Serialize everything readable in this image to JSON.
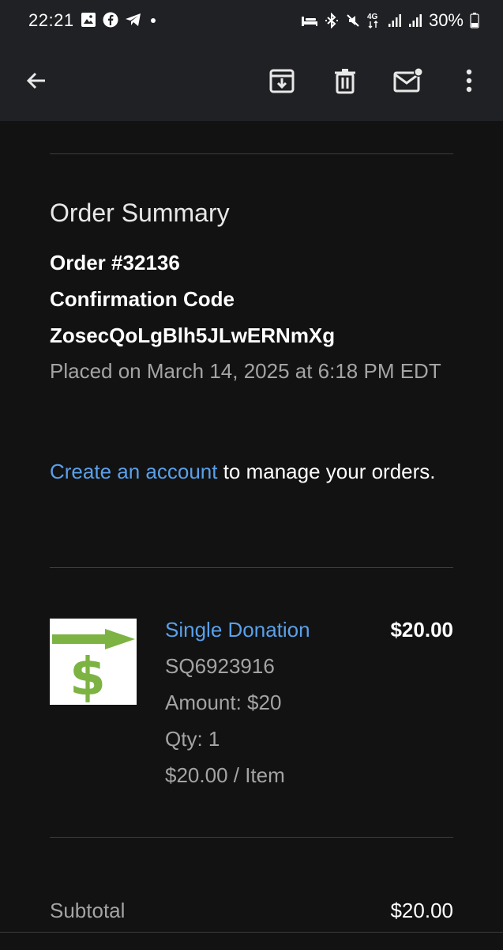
{
  "status_bar": {
    "time": "22:21",
    "battery_percent": "30%",
    "network_label": "4G",
    "left_icons": [
      "image-icon",
      "facebook-icon",
      "telegram-icon",
      "dot-icon"
    ],
    "right_icons": [
      "sleep-mode-icon",
      "bluetooth-icon",
      "mute-icon",
      "signal-icon",
      "signal-icon",
      "battery-icon"
    ]
  },
  "toolbar": {
    "icons": [
      "back-arrow-icon",
      "archive-icon",
      "delete-icon",
      "mark-unread-icon",
      "more-vert-icon"
    ]
  },
  "order": {
    "title": "Order Summary",
    "number": "Order #32136",
    "confirmation_label": "Confirmation Code",
    "confirmation_code": "ZosecQoLgBlh5JLwERNmXg",
    "placed_on": "Placed on March 14, 2025 at 6:18 PM EDT"
  },
  "account": {
    "link_text": "Create an account",
    "rest_text": " to manage your orders."
  },
  "item": {
    "name": "Single Donation",
    "price": "$20.00",
    "sku": "SQ6923916",
    "amount": "Amount: $20",
    "qty": "Qty: 1",
    "unit_price": "$20.00 / Item",
    "thumbnail_icon": "dollar-arrow-icon",
    "thumbnail_colors": {
      "arrow": "#7cb342",
      "dollar": "#7cb342",
      "background": "#ffffff"
    }
  },
  "totals": {
    "subtotal_label": "Subtotal",
    "subtotal_value": "$20.00"
  },
  "colors": {
    "background": "#121212",
    "app_bar": "#202124",
    "link": "#5aa0ea",
    "muted_text": "#a4a4a4"
  }
}
